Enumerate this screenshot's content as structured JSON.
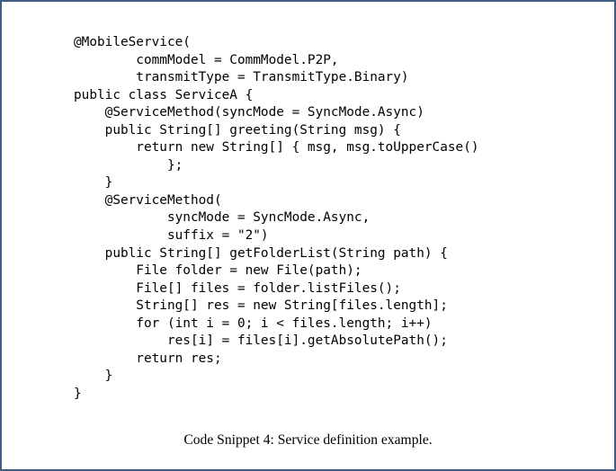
{
  "page": {
    "background_color": "#ffffff",
    "border_color": "#3f5e86",
    "text_color": "#000000"
  },
  "figure": {
    "caption": "Code Snippet 4: Service definition example.",
    "caption_label": "Code Snippet 4",
    "caption_number": "4",
    "caption_text": "Service definition example.",
    "language": "Java",
    "code_lines": [
      "@MobileService(",
      "        commModel = CommModel.P2P,",
      "        transmitType = TransmitType.Binary)",
      "public class ServiceA {",
      "    @ServiceMethod(syncMode = SyncMode.Async)",
      "    public String[] greeting(String msg) {",
      "        return new String[] { msg, msg.toUpperCase()",
      "            };",
      "    }",
      "    @ServiceMethod(",
      "            syncMode = SyncMode.Async,",
      "            suffix = \"2\")",
      "    public String[] getFolderList(String path) {",
      "        File folder = new File(path);",
      "        File[] files = folder.listFiles();",
      "        String[] res = new String[files.length];",
      "        for (int i = 0; i < files.length; i++)",
      "            res[i] = files[i].getAbsolutePath();",
      "        return res;",
      "    }",
      "}"
    ]
  }
}
